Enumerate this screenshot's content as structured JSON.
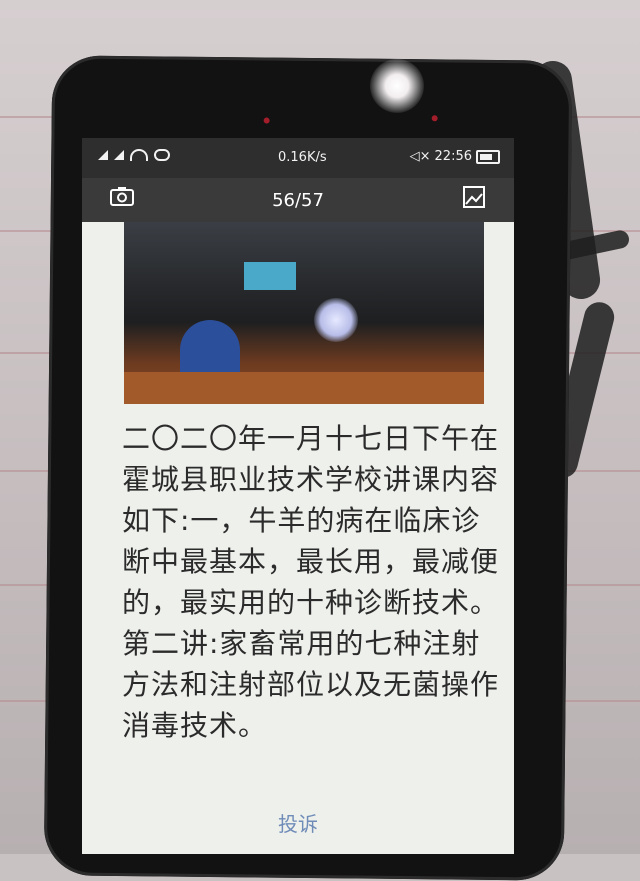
{
  "status_bar": {
    "network_speed": "0.16K/s",
    "time": "22:56"
  },
  "viewer": {
    "page_counter": "56/57"
  },
  "article": {
    "text": "二〇二〇年一月十七日下午在霍城县职业技术学校讲课内容如下:一，牛羊的病在临床诊断中最基本，最长用，最减便的，最实用的十种诊断技术。第二讲:家畜常用的七种注射方法和注射部位以及无菌操作消毒技术。"
  },
  "footer": {
    "complain_label": "投诉"
  }
}
